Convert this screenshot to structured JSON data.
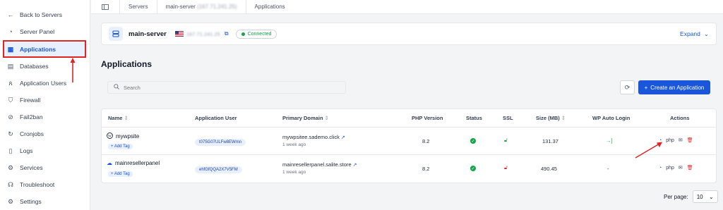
{
  "sidebar": {
    "items": [
      {
        "label": "Back to Servers",
        "icon": "arrow-left-icon"
      },
      {
        "label": "Server Panel",
        "icon": "gauge-icon"
      },
      {
        "label": "Applications",
        "icon": "apps-icon"
      },
      {
        "label": "Databases",
        "icon": "database-icon"
      },
      {
        "label": "Application Users",
        "icon": "users-icon"
      },
      {
        "label": "Firewall",
        "icon": "shield-icon"
      },
      {
        "label": "Fail2ban",
        "icon": "ban-icon"
      },
      {
        "label": "Cronjobs",
        "icon": "clock-icon"
      },
      {
        "label": "Logs",
        "icon": "file-icon"
      },
      {
        "label": "Services",
        "icon": "services-icon"
      },
      {
        "label": "Troubleshoot",
        "icon": "headset-icon"
      },
      {
        "label": "Settings",
        "icon": "gear-icon"
      }
    ],
    "active_index": 2
  },
  "breadcrumb": {
    "servers": "Servers",
    "server": "main-server",
    "server_ip": "(167.71.241.25)",
    "current": "Applications"
  },
  "server": {
    "name": "main-server",
    "ip": "167.71.241.25",
    "status": "Connected",
    "expand_label": "Expand"
  },
  "page": {
    "title": "Applications",
    "search_placeholder": "Search",
    "create_label": "Create an Application"
  },
  "table": {
    "headers": {
      "name": "Name",
      "user": "Application User",
      "domain": "Primary Domain",
      "php": "PHP Version",
      "status": "Status",
      "ssl": "SSL",
      "size": "Size (MB)",
      "autologin": "WP Auto Login",
      "actions": "Actions"
    },
    "add_tag": "+ Add Tag",
    "rows": [
      {
        "name": "mywpsite",
        "user": "t075G07ULFw8EWmn",
        "domain": "mywpsitee.sademo.click",
        "ago": "1 week ago",
        "php": "8.2",
        "size": "131.37",
        "autologin": "→]"
      },
      {
        "name": "mainresellerpanel",
        "user": "ehfGfQQA2X7V5FM",
        "domain": "mainresellerpanel.salite.store",
        "ago": "1 week ago",
        "php": "8.2",
        "size": "490.45",
        "autologin": "-"
      }
    ]
  },
  "pagination": {
    "per_page_label": "Per page:",
    "per_page_value": "10"
  },
  "colors": {
    "accent": "#1a56db",
    "success": "#16a34a",
    "danger": "#e02424"
  }
}
